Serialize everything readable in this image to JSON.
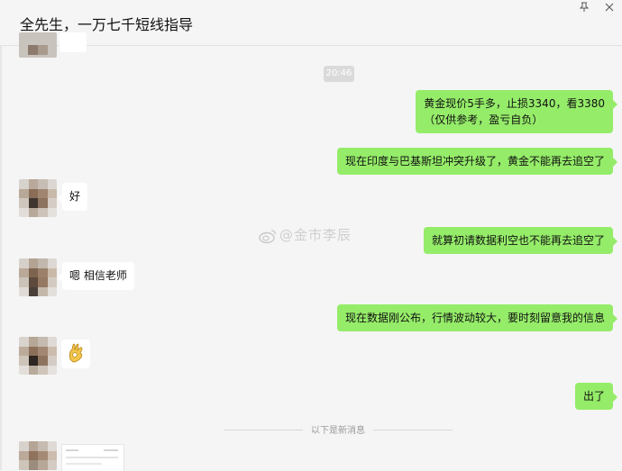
{
  "chat": {
    "title": "全先生，一万七千短线指导",
    "pin_icon": "pin-icon",
    "close_icon": "close-icon"
  },
  "timestamp": "20:46",
  "messages": [
    {
      "side": "out",
      "lines": [
        "黄金现价5手多，止损3340，看3380",
        "（仅供参考，盈亏自负）"
      ]
    },
    {
      "side": "out",
      "lines": [
        "现在印度与巴基斯坦冲突升级了，黄金不能再去追空了"
      ]
    },
    {
      "side": "in",
      "text": "好"
    },
    {
      "side": "out",
      "lines": [
        "就算初请数据利空也不能再去追空了"
      ]
    },
    {
      "side": "in",
      "text": "嗯  相信老师"
    },
    {
      "side": "out",
      "lines": [
        "现在数据刚公布，行情波动较大，要时刻留意我的信息"
      ]
    },
    {
      "side": "in",
      "emoji": "ok-hand-emoji"
    },
    {
      "side": "out",
      "lines": [
        "出了"
      ]
    }
  ],
  "divider": {
    "text": "以下是新消息"
  },
  "watermark": {
    "text": "@金市李辰",
    "icon": "weibo-icon"
  },
  "colors": {
    "background": "#f5f5f5",
    "bubble_out": "#95ec69",
    "bubble_in": "#ffffff"
  }
}
